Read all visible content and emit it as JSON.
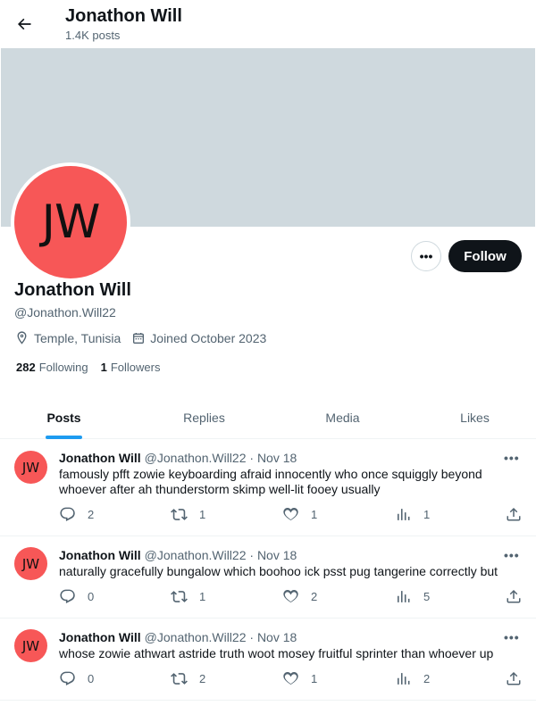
{
  "header": {
    "title": "Jonathon Will",
    "subtitle": "1.4K posts"
  },
  "profile": {
    "avatar_initials": "JW",
    "avatar_color": "#f75757",
    "banner_color": "#cfd9de",
    "name": "Jonathon Will",
    "handle": "@Jonathon.Will22",
    "location": "Temple, Tunisia",
    "joined": "Joined October 2023",
    "following_count": "282",
    "following_label": "Following",
    "followers_count": "1",
    "followers_label": "Followers",
    "more_label": "•••",
    "follow_label": "Follow"
  },
  "tabs": [
    {
      "label": "Posts",
      "active": true
    },
    {
      "label": "Replies",
      "active": false
    },
    {
      "label": "Media",
      "active": false
    },
    {
      "label": "Likes",
      "active": false
    }
  ],
  "accent_color": "#1d9bf0",
  "posts": [
    {
      "avatar_initials": "JW",
      "name": "Jonathon Will",
      "handle": "@Jonathon.Will22",
      "dot": "·",
      "date": "Nov 18",
      "menu": "•••",
      "text": "famously pfft zowie keyboarding afraid innocently who once squiggly beyond whoever after ah thunderstorm skimp well-lit fooey usually",
      "replies": "2",
      "reposts": "1",
      "likes": "1",
      "views": "1"
    },
    {
      "avatar_initials": "JW",
      "name": "Jonathon Will",
      "handle": "@Jonathon.Will22",
      "dot": "·",
      "date": "Nov 18",
      "menu": "•••",
      "text": "naturally gracefully bungalow which boohoo ick psst pug tangerine correctly but",
      "replies": "0",
      "reposts": "1",
      "likes": "2",
      "views": "5"
    },
    {
      "avatar_initials": "JW",
      "name": "Jonathon Will",
      "handle": "@Jonathon.Will22",
      "dot": "·",
      "date": "Nov 18",
      "menu": "•••",
      "text": "whose zowie athwart astride truth woot mosey fruitful sprinter than whoever up",
      "replies": "0",
      "reposts": "2",
      "likes": "1",
      "views": "2"
    }
  ]
}
